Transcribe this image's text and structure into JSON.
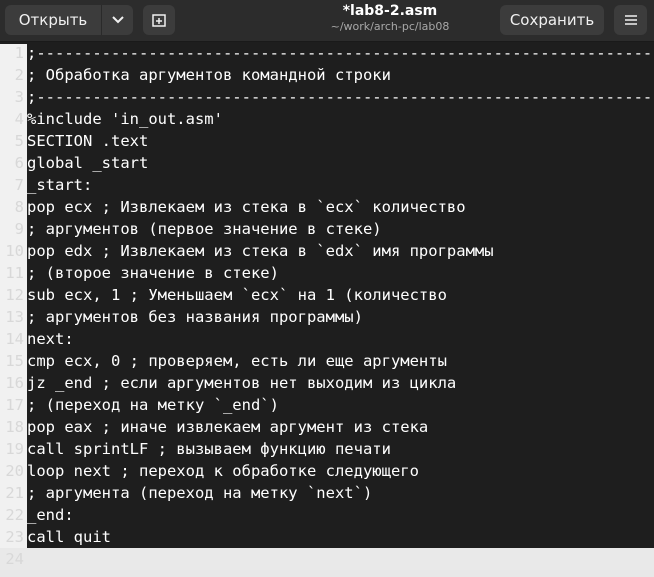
{
  "header": {
    "open_label": "Открыть",
    "save_label": "Сохранить",
    "title": "*lab8-2.asm",
    "subtitle": "~/work/arch-pc/lab08"
  },
  "editor": {
    "lines": [
      {
        "num": "1",
        "text": ";------------------------------------------------------------------"
      },
      {
        "num": "2",
        "text": "; Обработка аргументов командной строки"
      },
      {
        "num": "3",
        "text": ";------------------------------------------------------------------"
      },
      {
        "num": "4",
        "text": "%include 'in_out.asm'"
      },
      {
        "num": "5",
        "text": "SECTION .text"
      },
      {
        "num": "6",
        "text": "global _start"
      },
      {
        "num": "7",
        "text": "_start:"
      },
      {
        "num": "8",
        "text": "pop ecx ; Извлекаем из стека в `ecx` количество"
      },
      {
        "num": "9",
        "text": "; аргументов (первое значение в стеке)"
      },
      {
        "num": "10",
        "text": "pop edx ; Извлекаем из стека в `edx` имя программы"
      },
      {
        "num": "11",
        "text": "; (второе значение в стеке)"
      },
      {
        "num": "12",
        "text": "sub ecx, 1 ; Уменьшаем `ecx` на 1 (количество"
      },
      {
        "num": "13",
        "text": "; аргументов без названия программы)"
      },
      {
        "num": "14",
        "text": "next:"
      },
      {
        "num": "15",
        "text": "cmp ecx, 0 ; проверяем, есть ли еще аргументы"
      },
      {
        "num": "16",
        "text": "jz _end ; если аргументов нет выходим из цикла"
      },
      {
        "num": "17",
        "text": "; (переход на метку `_end`)"
      },
      {
        "num": "18",
        "text": "pop eax ; иначе извлекаем аргумент из стека"
      },
      {
        "num": "19",
        "text": "call sprintLF ; вызываем функцию печати"
      },
      {
        "num": "20",
        "text": "loop next ; переход к обработке следующего"
      },
      {
        "num": "21",
        "text": "; аргумента (переход на метку `next`)"
      },
      {
        "num": "22",
        "text": "_end:"
      },
      {
        "num": "23",
        "text": "call quit"
      },
      {
        "num": "24",
        "text": ""
      }
    ]
  },
  "icons": {
    "open_dropdown": "chevron-down-icon",
    "new_tab": "new-tab-icon",
    "menu": "hamburger-menu-icon"
  }
}
